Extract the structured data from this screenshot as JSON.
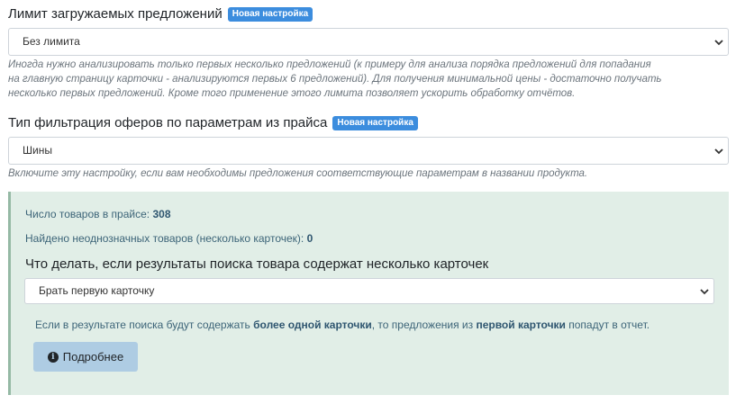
{
  "limit": {
    "label": "Лимит загружаемых предложений",
    "badge": "Новая настройка",
    "selected": "Без лимита",
    "help": [
      "Иногда нужно анализировать только первых несколько предложений (к примеру для анализа порядка предложений для попадания",
      "на главную страницу карточки - анализируются первых 6 предложений). Для получения минимальной цены - достаточно получать",
      "несколько первых предложений. Кроме того применение этого лимита позволяет ускорить обработку отчётов."
    ]
  },
  "filter": {
    "label": "Тип фильтрация оферов по параметрам из прайса",
    "badge": "Новая настройка",
    "selected": "Шины",
    "help": "Включите эту настройку, если вам необходимы предложения соответствующие параметрам в названии продукта."
  },
  "panel": {
    "count_label": "Число товаров в прайсе:",
    "count_value": "308",
    "ambiguous_label": "Найдено неоднозначных товаров (несколько карточек):",
    "ambiguous_value": "0",
    "question": "Что делать, если результаты поиска товара содержат несколько карточек",
    "selected": "Брать первую карточку",
    "info_pre": "Если в результате поиска будут содержать ",
    "info_b1": "более одной карточки",
    "info_mid": ", то предложения из ",
    "info_b2": "первой карточки",
    "info_post": " попадут в отчет.",
    "more_button": "Подробнее",
    "more_icon": "info-circle-icon"
  }
}
